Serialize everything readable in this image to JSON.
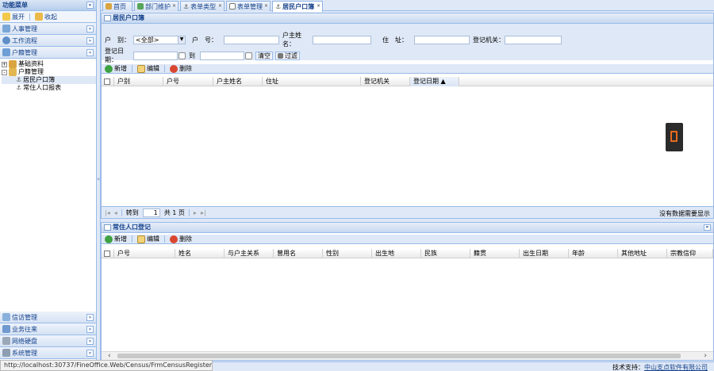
{
  "sidebar": {
    "title": "功能菜单",
    "expand_label": "展开",
    "collapse_label": "收起",
    "accordion_top": [
      {
        "label": "人事管理"
      },
      {
        "label": "工作流程"
      },
      {
        "label": "户籍管理"
      }
    ],
    "tree": [
      {
        "label": "基础资料",
        "level": 0,
        "toggle": "+"
      },
      {
        "label": "户籍管理",
        "level": 0,
        "toggle": "-"
      },
      {
        "label": "居民户口簿",
        "level": 1,
        "selected": true
      },
      {
        "label": "常住人口报表",
        "level": 1
      }
    ],
    "accordion_bottom": [
      {
        "label": "信访管理"
      },
      {
        "label": "业务往来"
      },
      {
        "label": "网络硬盘"
      },
      {
        "label": "系统管理"
      }
    ]
  },
  "tabs": [
    {
      "label": "首页",
      "closable": false
    },
    {
      "label": "部门维护",
      "closable": true
    },
    {
      "label": "表单类型",
      "closable": true
    },
    {
      "label": "表单管理",
      "closable": true
    },
    {
      "label": "居民户口簿",
      "closable": true,
      "active": true
    }
  ],
  "census_panel": {
    "title": "居民户口簿",
    "fields": {
      "hubie_label": "户　别：",
      "hubie_value": "<全部>",
      "huhao_label": "户　号：",
      "huzhu_label": "户主姓名：",
      "address_label": "住　址：",
      "organ_label": "登记机关：",
      "date_label": "登记日期：",
      "to_label": "到",
      "clear_button": "清空",
      "filter_button": "过滤"
    },
    "toolbar": {
      "add": "新增",
      "edit": "编辑",
      "delete": "删除"
    },
    "columns": [
      "户别",
      "户号",
      "户主姓名",
      "住址",
      "登记机关",
      "登记日期 ▲"
    ],
    "pager": {
      "goto": "转到",
      "page": "1",
      "total": "共 1 页",
      "empty": "没有数据需要显示"
    }
  },
  "resident_panel": {
    "title": "常住人口登记",
    "toolbar": {
      "add": "新增",
      "edit": "编辑",
      "delete": "删除"
    },
    "columns": [
      "户号",
      "姓名",
      "与户主关系",
      "曾用名",
      "性别",
      "出生地",
      "民族",
      "籍贯",
      "出生日期",
      "年龄",
      "其他地址",
      "宗教信仰"
    ]
  },
  "status": {
    "url": "http://localhost:30737/FineOffice.Web/Census/FrmCensusRegister.aspx",
    "support_label": "技术支持：",
    "company": "中山支点软件有限公司"
  },
  "colors": {
    "accent": "#15428b",
    "border": "#99bbe8",
    "header": "#dfe8f6"
  }
}
